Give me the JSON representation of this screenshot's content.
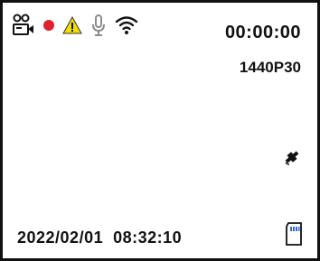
{
  "status_bar": {
    "icons": [
      "dual-camera-icon",
      "record-dot-icon",
      "warning-icon",
      "microphone-icon",
      "wifi-icon"
    ],
    "colors": {
      "record": "#e0202c",
      "warning_fill": "#f2e000",
      "warning_mark": "#111111",
      "mic_outline": "#8c8c8c"
    }
  },
  "recording": {
    "elapsed": "00:00:00",
    "resolution": "1440P30"
  },
  "gps": {
    "icon": "gps-satellite-icon"
  },
  "footer": {
    "datetime": "2022/02/01  08:32:10",
    "sd_icon": "sd-card-icon"
  }
}
